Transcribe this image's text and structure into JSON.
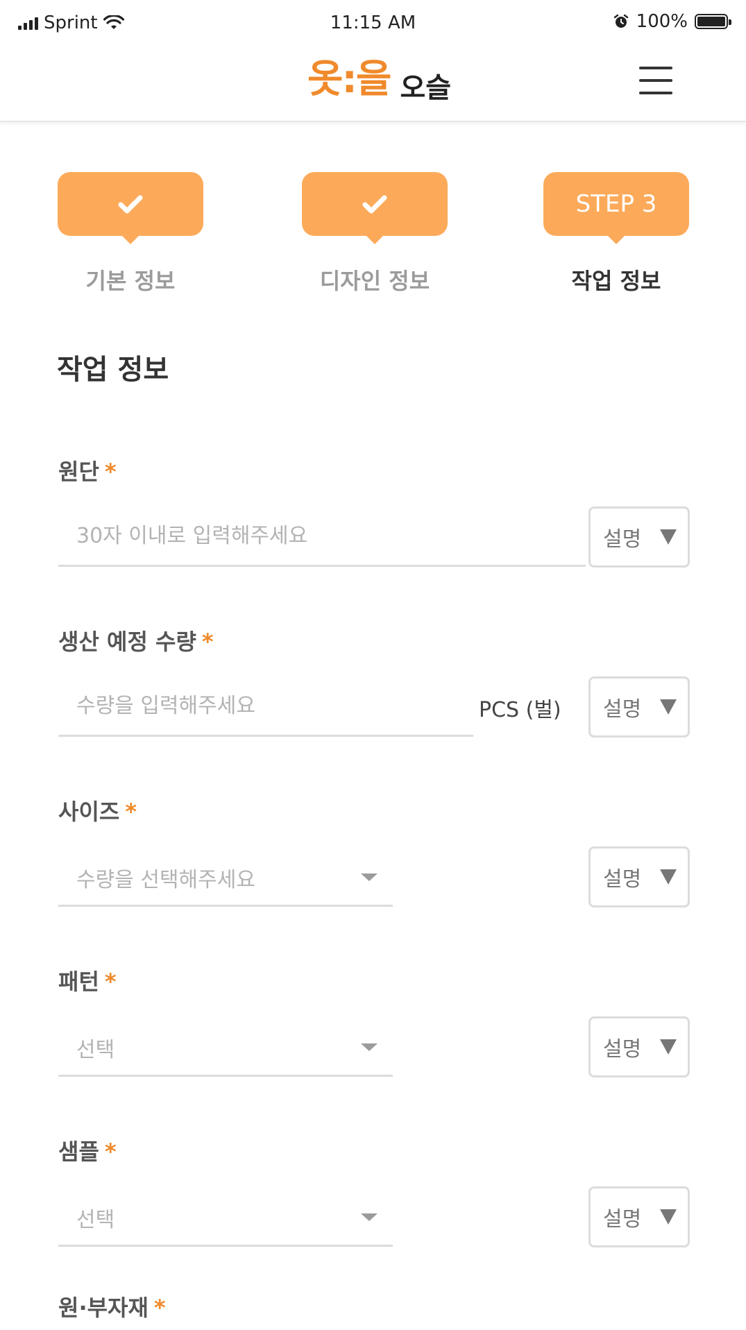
{
  "status_bar": {
    "carrier": "Sprint",
    "time": "11:15 AM",
    "battery": "100%",
    "battery_level": 1.0
  },
  "header": {
    "logo_mark": "옷:을",
    "logo_text": "오슬"
  },
  "stepper": {
    "steps": [
      {
        "badge": "",
        "label": "기본 정보",
        "state": "done"
      },
      {
        "badge": "",
        "label": "디자인 정보",
        "state": "done"
      },
      {
        "badge": "STEP 3",
        "label": "작업 정보",
        "state": "active"
      }
    ]
  },
  "form": {
    "section_title": "작업 정보",
    "required_mark": "*",
    "desc_label": "설명",
    "fields": [
      {
        "label": "원단",
        "type": "text",
        "placeholder": "30자 이내로 입력해주세요",
        "value": ""
      },
      {
        "label": "생산 예정 수량",
        "type": "text",
        "placeholder": "수량을 입력해주세요",
        "value": "",
        "unit": "PCS (벌)"
      },
      {
        "label": "사이즈",
        "type": "select",
        "selected": "수량을 선택해주세요"
      },
      {
        "label": "패턴",
        "type": "select",
        "selected": "선택"
      },
      {
        "label": "샘플",
        "type": "select",
        "selected": "선택"
      },
      {
        "label": "원·부자재"
      }
    ]
  },
  "colors": {
    "accent": "#fcaa5a",
    "logo": "#f08a2c",
    "required": "#f08a2c"
  }
}
